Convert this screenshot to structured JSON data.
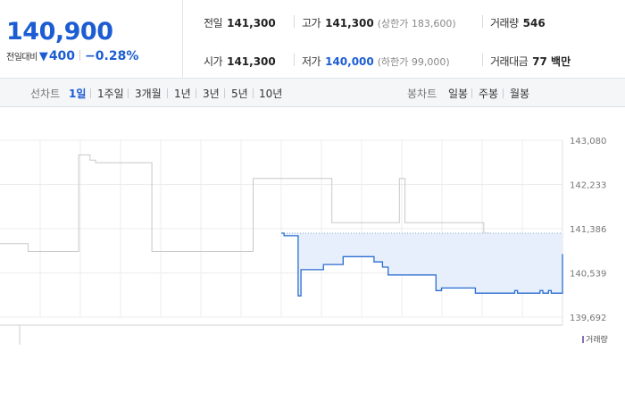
{
  "quote": {
    "price": "140,900",
    "change_label": "전일대비",
    "change_direction": "down",
    "change_value": "400",
    "change_pct": "−0.28%",
    "color_down": "#1c5dd3"
  },
  "stats": {
    "prev_label": "전일",
    "prev_value": "141,300",
    "open_label": "시가",
    "open_value": "141,300",
    "high_label": "고가",
    "high_value": "141,300",
    "high_note": "(상한가 183,600)",
    "low_label": "저가",
    "low_value": "140,000",
    "low_note": "(하한가 99,000)",
    "volume_label": "거래량",
    "volume_value": "546",
    "amount_label": "거래대금",
    "amount_value": "77 백만"
  },
  "toolbar": {
    "line_label": "선차트",
    "periods": [
      "1일",
      "1주일",
      "3개월",
      "1년",
      "3년",
      "5년",
      "10년"
    ],
    "active_period": "1일",
    "candle_label": "봉차트",
    "candles": [
      "일봉",
      "주봉",
      "월봉"
    ]
  },
  "chart_data": {
    "type": "line",
    "title": "",
    "xlabel": "",
    "ylabel": "",
    "y_ticks": [
      "143,080",
      "142,233",
      "141,386",
      "140,539",
      "139,692"
    ],
    "ylim": [
      139692,
      143080
    ],
    "previous_close": 141300,
    "legend": "거래량",
    "series": [
      {
        "style": "previous day, grey",
        "color": "#c8c8c8",
        "x": [
          0,
          1,
          2,
          3,
          4,
          5,
          6,
          7,
          8,
          9,
          10,
          11,
          12,
          13,
          14,
          15,
          16,
          17,
          18,
          19,
          20,
          21,
          22,
          23,
          24,
          25,
          26,
          27,
          28,
          29,
          30,
          31,
          32,
          33,
          34,
          35,
          36,
          37,
          38,
          39,
          40,
          41,
          42,
          43,
          44,
          45,
          46,
          47,
          48,
          49,
          50,
          51,
          52,
          53,
          54,
          55,
          56,
          57,
          58,
          59,
          60,
          61,
          62,
          63,
          64,
          65,
          66,
          67,
          68,
          69,
          70,
          71,
          72,
          73,
          74,
          75,
          76,
          77,
          78,
          79,
          80,
          81,
          82,
          83,
          84,
          85,
          86,
          87,
          88,
          89,
          90,
          91,
          92,
          93,
          94,
          95,
          96,
          97,
          98,
          99,
          100
        ],
        "values": [
          141100,
          141100,
          141100,
          141100,
          141100,
          140950,
          140950,
          140950,
          140950,
          140950,
          140950,
          140950,
          140950,
          140950,
          142800,
          142800,
          142700,
          142650,
          142650,
          142650,
          142650,
          142650,
          142650,
          142650,
          142650,
          142650,
          142650,
          140950,
          140950,
          140950,
          140950,
          140950,
          140950,
          140950,
          140950,
          140950,
          140950,
          140950,
          140950,
          140950,
          140950,
          140950,
          140950,
          140950,
          140950,
          142350,
          142350,
          142350,
          142350,
          142350,
          142350,
          142350,
          142350,
          142350,
          142350,
          142350,
          142350,
          142350,
          142350,
          141500,
          141500,
          141500,
          141500,
          141500,
          141500,
          141500,
          141500,
          141500,
          141500,
          141500,
          141500,
          142350,
          141500,
          141500,
          141500,
          141500,
          141500,
          141500,
          141500,
          141500,
          141500,
          141500,
          141500,
          141500,
          141500,
          141500,
          141300,
          141150,
          140650,
          140650,
          140650,
          140650,
          140650,
          141100,
          140650,
          140650,
          141100,
          140650,
          140650,
          141100,
          141100
        ]
      },
      {
        "style": "today, blue with shaded area",
        "color": "#2b6dd1",
        "fill": "#e6effb",
        "x": [
          0,
          1,
          2,
          3,
          4,
          5,
          6,
          7,
          8,
          9,
          10,
          11,
          12,
          13,
          14,
          15,
          16,
          17,
          18,
          19,
          20,
          21,
          22,
          23,
          24,
          25,
          26,
          27,
          28,
          29,
          30,
          31,
          32,
          33,
          34,
          35,
          36,
          37,
          38,
          39,
          40,
          41,
          42,
          43,
          44,
          45,
          46,
          47,
          48,
          49,
          50,
          51,
          52,
          53,
          54,
          55,
          56,
          57,
          58,
          59,
          60,
          61,
          62,
          63,
          64,
          65,
          66,
          67,
          68,
          69,
          70,
          71,
          72,
          73,
          74,
          75,
          76,
          77,
          78,
          79,
          80,
          81,
          82,
          83,
          84,
          85,
          86,
          87,
          88,
          89,
          90,
          91,
          92,
          93,
          94,
          95,
          96,
          97,
          98,
          99,
          100
        ],
        "values": [
          141300,
          141250,
          141250,
          141250,
          141250,
          141250,
          140100,
          140600,
          140600,
          140600,
          140600,
          140600,
          140600,
          140600,
          140600,
          140700,
          140700,
          140700,
          140700,
          140700,
          140700,
          140700,
          140850,
          140850,
          140850,
          140850,
          140850,
          140850,
          140850,
          140850,
          140850,
          140850,
          140850,
          140750,
          140750,
          140750,
          140650,
          140650,
          140500,
          140500,
          140500,
          140500,
          140500,
          140500,
          140500,
          140500,
          140500,
          140500,
          140500,
          140500,
          140500,
          140500,
          140500,
          140500,
          140500,
          140200,
          140200,
          140250,
          140250,
          140250,
          140250,
          140250,
          140250,
          140250,
          140250,
          140250,
          140250,
          140250,
          140250,
          140150,
          140150,
          140150,
          140150,
          140150,
          140150,
          140150,
          140150,
          140150,
          140150,
          140150,
          140150,
          140150,
          140150,
          140200,
          140150,
          140150,
          140150,
          140150,
          140150,
          140150,
          140150,
          140150,
          140200,
          140150,
          140150,
          140200,
          140150,
          140150,
          140150,
          140150,
          140900
        ],
        "x_start_fraction": 0.5
      }
    ]
  }
}
